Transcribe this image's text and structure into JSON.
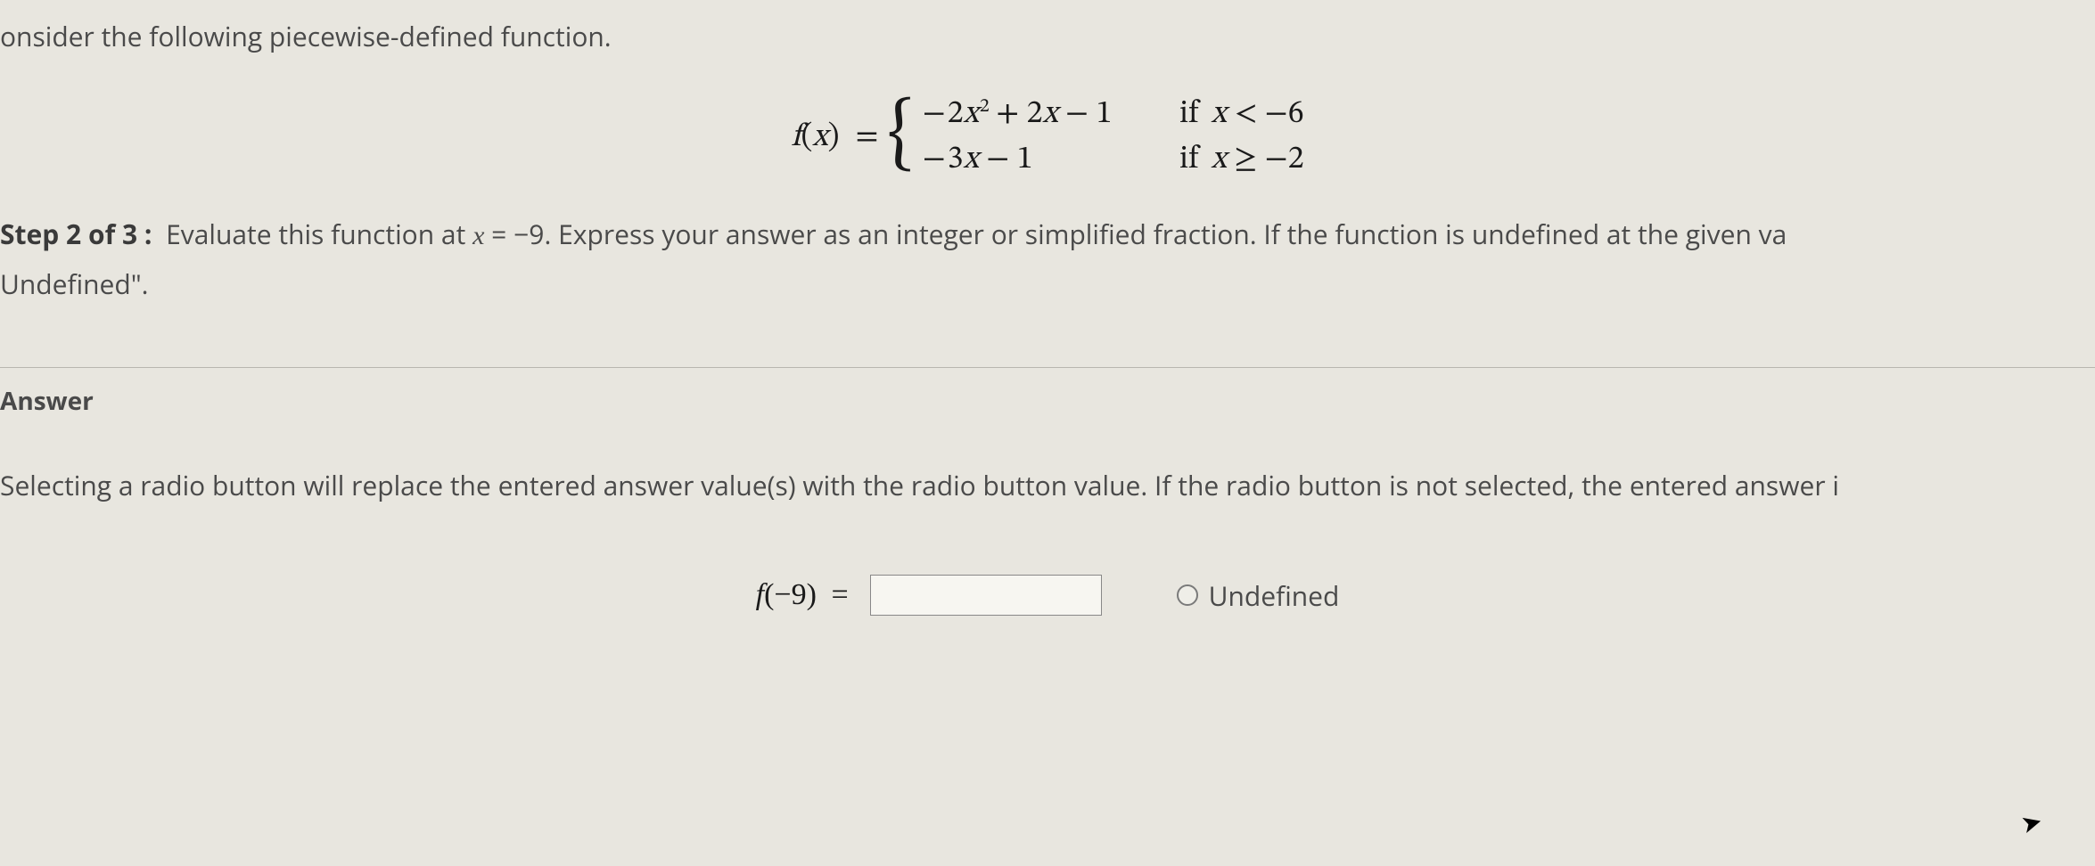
{
  "intro": "onsider the following piecewise-defined function.",
  "function": {
    "lhs_f": "f",
    "lhs_x": "x",
    "eq": "=",
    "piece1": {
      "expr_prefix_sign": "−",
      "expr_coef1": "2",
      "expr_var1": "x",
      "expr_pow": "2",
      "expr_op1": "+",
      "expr_coef2": "2",
      "expr_var2": "x",
      "expr_op2": "−",
      "expr_const": "1",
      "cond_if": "if",
      "cond_var": "x",
      "cond_op": "<",
      "cond_sign": "−",
      "cond_val": "6"
    },
    "piece2": {
      "expr_prefix_sign": "−",
      "expr_coef1": "3",
      "expr_var1": "x",
      "expr_op1": "−",
      "expr_const": "1",
      "cond_if": "if",
      "cond_var": "x",
      "cond_op": "≥",
      "cond_sign": "−",
      "cond_val": "2"
    }
  },
  "step": {
    "label": "Step 2 of 3 :",
    "text_a": "Evaluate this function at ",
    "eval_var": "x",
    "eval_eq": " = ",
    "eval_sign": "−",
    "eval_val": "9",
    "text_b": ". Express your answer as an integer or simplified fraction. If the function is undefined at the given va",
    "text_c": "Undefined\"."
  },
  "answer_heading": "Answer",
  "radio_note": "Selecting a radio button will replace the entered answer value(s) with the radio button value. If the radio button is not selected, the entered answer i",
  "answer": {
    "f": "f",
    "arg_sign": "−",
    "arg_val": "9",
    "eq": "=",
    "input_value": "",
    "undefined_label": "Undefined"
  }
}
